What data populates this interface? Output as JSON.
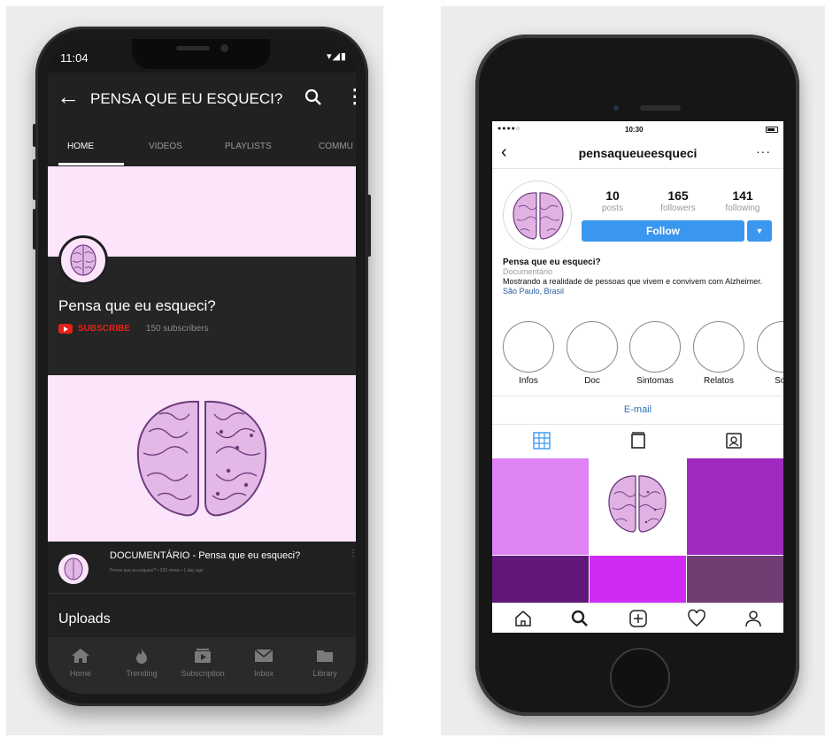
{
  "youtube": {
    "status_time": "11:04",
    "status_icons": "▾◢▮",
    "header_title": "PENSA QUE EU ESQUECI?",
    "tabs": [
      {
        "label": "HOME",
        "active": true
      },
      {
        "label": "VIDEOS",
        "active": false
      },
      {
        "label": "PLAYLISTS",
        "active": false
      },
      {
        "label": "COMMU",
        "active": false
      }
    ],
    "channel_name": "Pensa que eu esqueci?",
    "subscribe_label": "SUBSCRIBE",
    "subscriber_count": "150 subscribers",
    "video_title": "DOCUMENTÁRIO - Pensa que eu esqueci?",
    "video_meta": "Pensa que eu esqueci? • 320 views • 1 day ago",
    "uploads_label": "Uploads",
    "nav": [
      {
        "label": "Home",
        "icon": "home-icon"
      },
      {
        "label": "Trending",
        "icon": "flame-icon"
      },
      {
        "label": "Subscription",
        "icon": "subscriptions-icon"
      },
      {
        "label": "Inbox",
        "icon": "mail-icon"
      },
      {
        "label": "Library",
        "icon": "folder-icon"
      }
    ],
    "colors": {
      "brand_red": "#e62117",
      "banner_pink": "#fce4fb",
      "dark": "#212121"
    }
  },
  "instagram": {
    "status_signal": "●●●●○",
    "status_time": "10:30",
    "username": "pensaqueueesqueci",
    "stats": [
      {
        "value": "10",
        "label": "posts"
      },
      {
        "value": "165",
        "label": "followers"
      },
      {
        "value": "141",
        "label": "following"
      }
    ],
    "follow_label": "Follow",
    "bio": {
      "name": "Pensa que eu esqueci?",
      "category": "Documentário",
      "text": "Mostrando a realidade de pessoas que vivem e convivem com Alzheimer.",
      "location": "São Paulo, Brasil"
    },
    "highlights": [
      "Infos",
      "Doc",
      "Sintomas",
      "Relatos",
      "Sob"
    ],
    "email_label": "E-mail",
    "grid_colors": [
      "#de82f4",
      "#ffffff",
      "#a02ac0",
      "#611878",
      "#cf2bf4",
      "#703e73"
    ],
    "colors": {
      "follow_blue": "#3a97ef",
      "link_blue": "#2f6fb5"
    }
  }
}
